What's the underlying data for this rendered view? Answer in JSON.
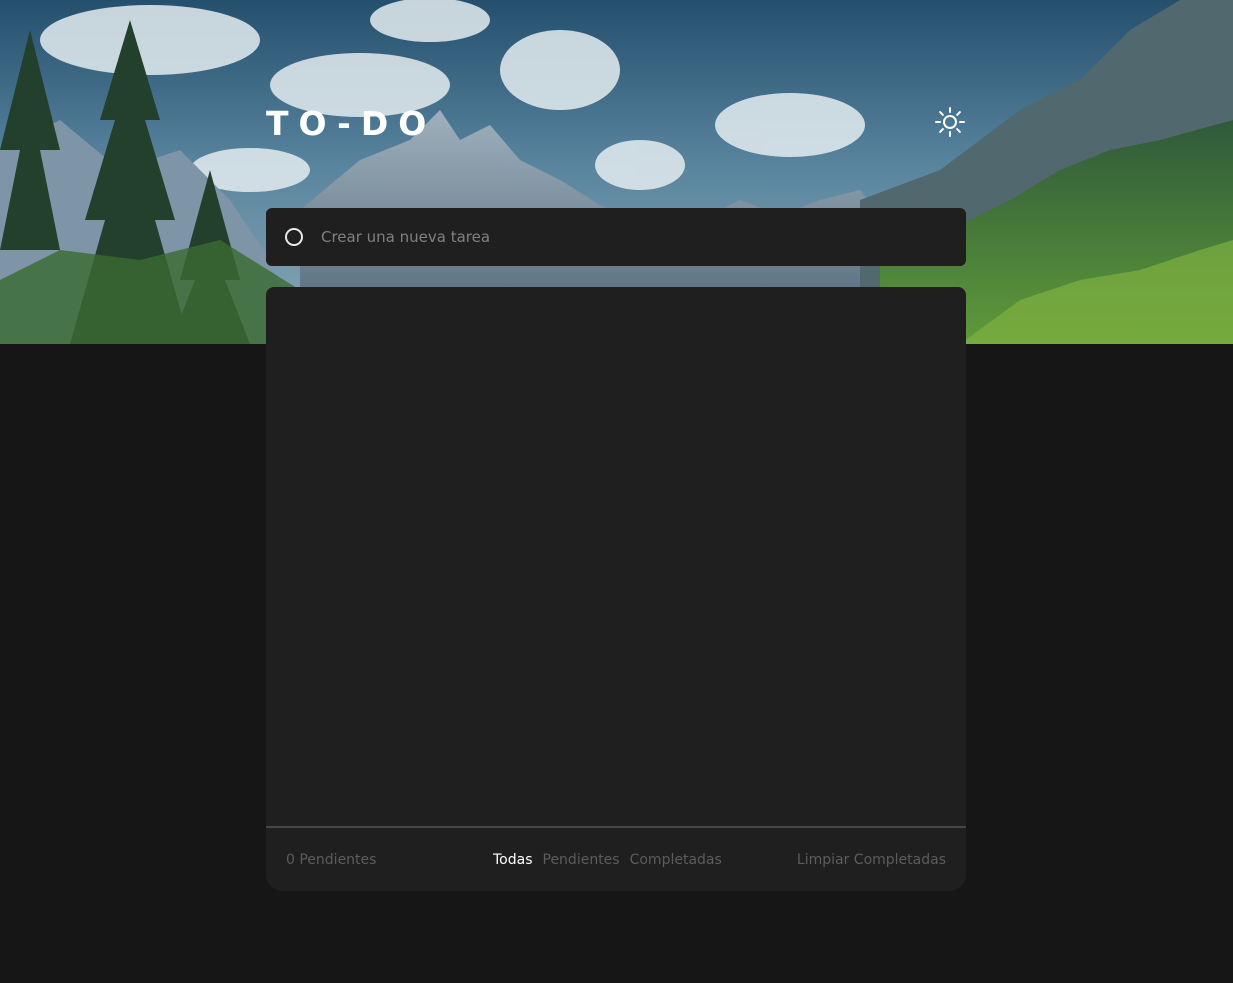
{
  "app": {
    "title": "TO-DO"
  },
  "theme_toggle": {
    "icon": "sun-icon"
  },
  "new_task": {
    "placeholder": "Crear una nueva tarea",
    "value": ""
  },
  "tasks": [],
  "footer": {
    "count_label": "0 Pendientes",
    "filters": [
      {
        "label": "Todas",
        "active": true
      },
      {
        "label": "Pendientes",
        "active": false
      },
      {
        "label": "Completadas",
        "active": false
      }
    ],
    "clear_label": "Limpiar Completadas"
  },
  "colors": {
    "page_background": "#161616",
    "card_background": "#1f1f1f",
    "active_filter": "#ffffff",
    "muted_text": "#5c5c5c"
  }
}
